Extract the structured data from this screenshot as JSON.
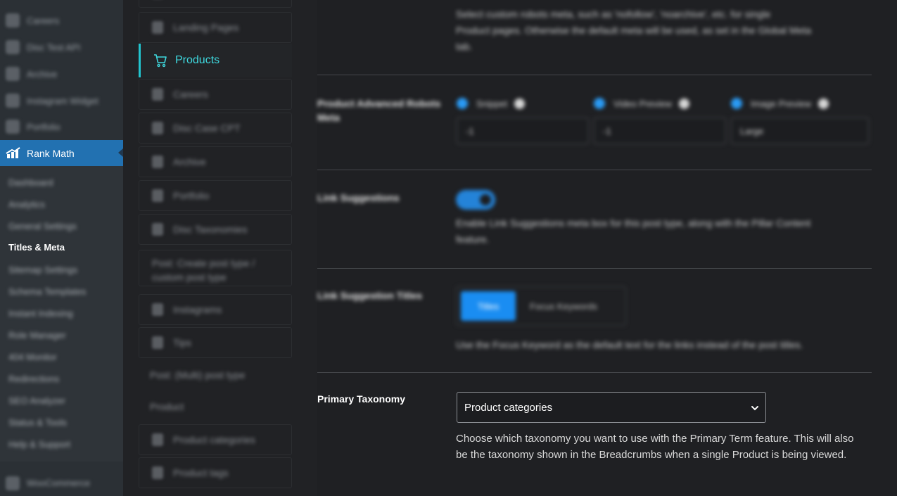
{
  "sidebar": {
    "top_items": [
      "Careers",
      "Disc Test API",
      "Archive",
      "Instagram Widget",
      "Portfolio"
    ],
    "active_menu": "Rank Math",
    "submenu": [
      "Dashboard",
      "Analytics",
      "General Settings",
      "Titles & Meta",
      "Sitemap Settings",
      "Schema Templates",
      "Instant Indexing",
      "Role Manager",
      "404 Monitor",
      "Redirections",
      "SEO Analyzer",
      "Status & Tools",
      "Help & Support"
    ],
    "current_submenu": "Titles & Meta",
    "bottom_item": "WooCommerce"
  },
  "post_types": {
    "items_top": [
      "Landing Pages"
    ],
    "active": "Products",
    "items": [
      "Careers",
      "Disc Case CPT",
      "Archive",
      "Portfolio",
      "Disc Taxonomies"
    ],
    "tall_item": "Post: Create post type / custom post type",
    "items_mid": [
      "Instagrams",
      "Tips"
    ],
    "heading_1": "Post: (Multi) post type",
    "heading_2": "Product",
    "taxonomies": [
      "Product categories",
      "Product tags"
    ],
    "accent_color": "#3ed8de"
  },
  "settings": {
    "top_help": [
      "Select custom robots meta, such as 'nofollow', 'noarchive', etc. for single",
      "Product pages. Otherwise the default meta will be used, as set in the Global Meta",
      "tab."
    ],
    "advanced_robots": {
      "label_1": "Product Advanced Robots",
      "label_2": "Meta",
      "snippet_label": "Snippet",
      "snippet_value": "-1",
      "video_label": "Video Preview",
      "video_value": "-1",
      "image_label": "Image Preview",
      "image_value": "Large"
    },
    "link_suggestions": {
      "label": "Link Suggestions",
      "enabled": true,
      "help_1": "Enable Link Suggestions meta box for this post type, along with the Pillar Content",
      "help_2": "feature."
    },
    "link_suggestion_titles": {
      "label": "Link Suggestion Titles",
      "option_on": "Titles",
      "option_off": "Focus Keywords",
      "help": "Use the Focus Keyword as the default text for the links instead of the post titles."
    },
    "primary_taxonomy": {
      "label": "Primary Taxonomy",
      "selected": "Product categories",
      "help": "Choose which taxonomy you want to use with the Primary Term feature. This will also be the taxonomy shown in the Breadcrumbs when a single Product is being viewed."
    }
  },
  "colors": {
    "menu_active_bg": "#2271b1",
    "toggle_on": "#2483d8",
    "checkbox_on": "#2a9bf5"
  }
}
